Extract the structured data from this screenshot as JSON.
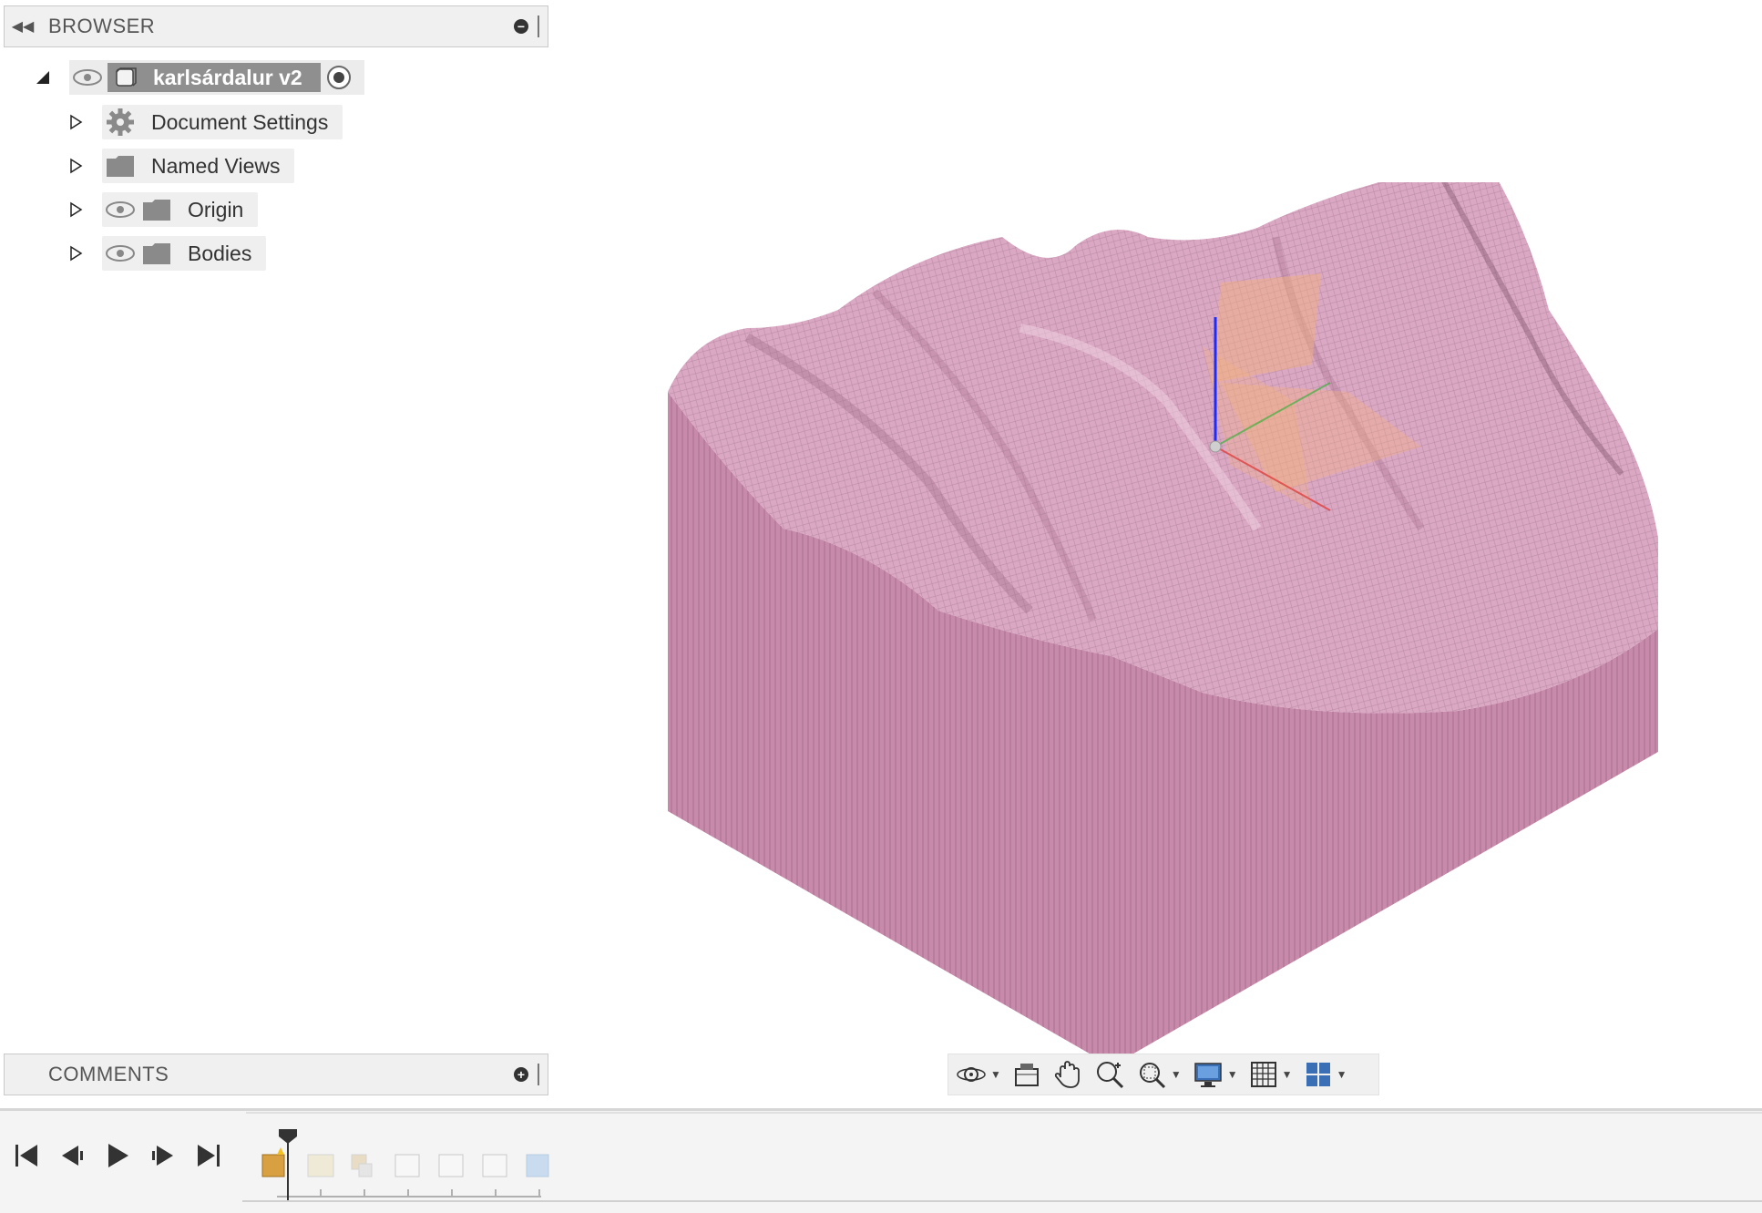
{
  "browser": {
    "title": "BROWSER",
    "root": {
      "label": "karlsárdalur v2"
    },
    "items": [
      {
        "label": "Document Settings",
        "icon": "gear-icon"
      },
      {
        "label": "Named Views",
        "icon": "folder-icon"
      },
      {
        "label": "Origin",
        "icon": "folder-icon"
      },
      {
        "label": "Bodies",
        "icon": "folder-icon"
      }
    ]
  },
  "comments": {
    "title": "COMMENTS"
  },
  "viewport": {
    "model_color": "#d9a2c0",
    "side_color": "#c88aaa",
    "axis_colors": {
      "z": "#1a2cff",
      "x": "#e04040",
      "y": "#40b040"
    },
    "plane_color": "#f5b27a"
  },
  "navbar": {
    "items": [
      "orbit-icon",
      "look-at-icon",
      "pan-icon",
      "zoom-icon",
      "fit-icon",
      "display-settings-icon",
      "grid-settings-icon",
      "viewports-icon"
    ]
  },
  "timeline": {
    "controls": [
      "skip-to-start",
      "step-back",
      "play",
      "step-forward",
      "skip-to-end"
    ],
    "features": [
      "import-feature",
      "sketch-feature",
      "mesh-feature",
      "edit-feature-1",
      "edit-feature-2",
      "edit-feature-3",
      "body-feature"
    ]
  }
}
